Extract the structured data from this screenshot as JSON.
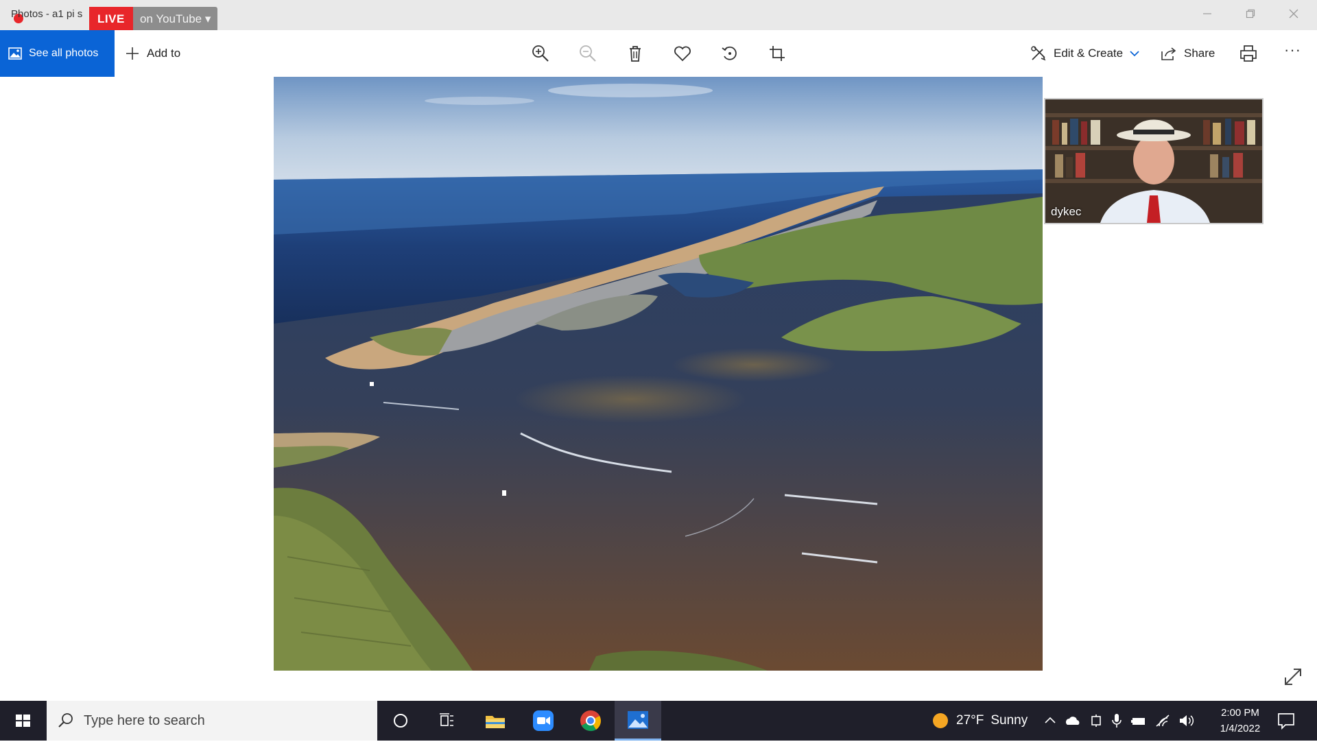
{
  "window": {
    "title": "Photos - a1 pi s",
    "live_label": "LIVE",
    "stream_label": "on YouTube ▾"
  },
  "toolbar": {
    "see_all_photos": "See all photos",
    "add_to": "Add to",
    "edit_create": "Edit & Create",
    "share": "Share",
    "more": "···"
  },
  "video": {
    "participant": "dykec"
  },
  "taskbar": {
    "search_placeholder": "Type here to search",
    "weather_temp": "27°F",
    "weather_cond": "Sunny",
    "time": "2:00 PM",
    "date": "1/4/2022"
  },
  "colors": {
    "accent": "#0a64d6",
    "live": "#e8262a",
    "taskbar": "#1f1f2a"
  }
}
